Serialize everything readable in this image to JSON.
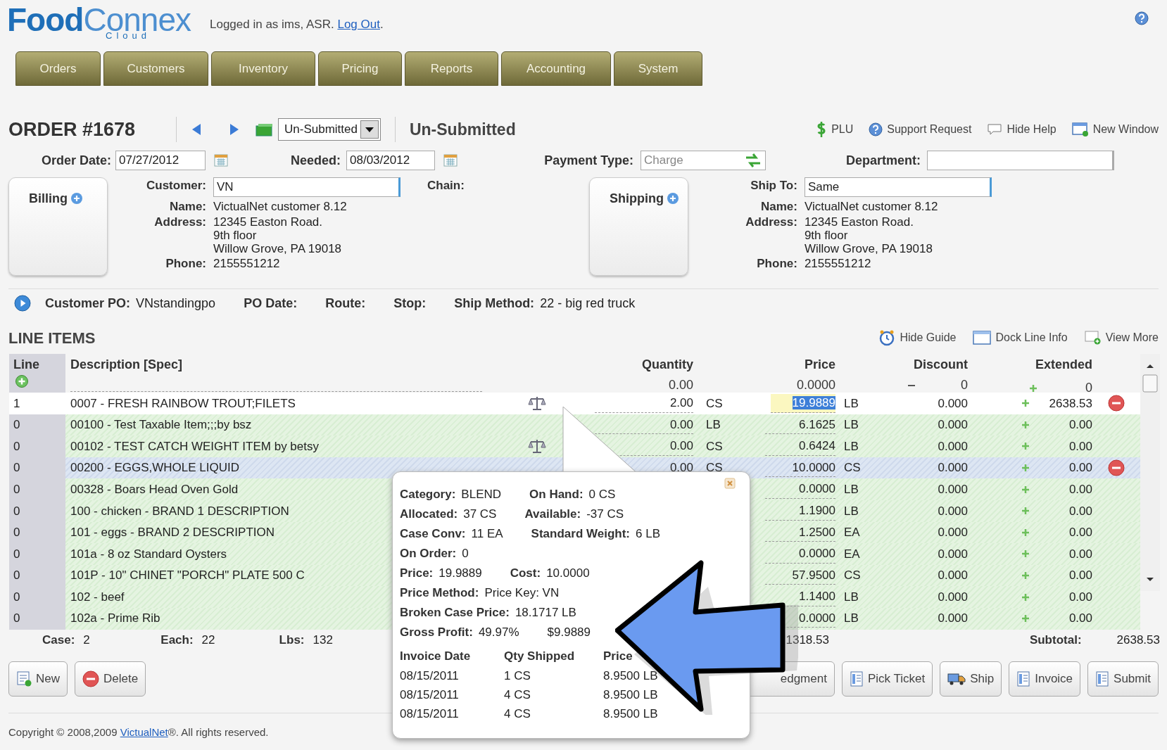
{
  "header": {
    "logo": {
      "primary": "Food",
      "secondary": "Connex",
      "sub": "Cloud"
    },
    "session": {
      "text": "Logged in as ims, ASR. ",
      "link": "Log Out",
      "after": "."
    }
  },
  "nav_tabs": [
    "Orders",
    "Customers",
    "Inventory",
    "Pricing",
    "Reports",
    "Accounting",
    "System"
  ],
  "order": {
    "title": "ORDER #1678",
    "status_select": "Un-Submitted",
    "status": "Un-Submitted",
    "actions": [
      {
        "label": "PLU",
        "kind": "dollar"
      },
      {
        "label": "Support Request",
        "kind": "help"
      },
      {
        "label": "Hide Help",
        "kind": "bubble"
      },
      {
        "label": "New Window",
        "kind": "window"
      }
    ]
  },
  "dates": {
    "order_date_label": "Order Date:",
    "order_date": "07/27/2012",
    "needed_label": "Needed:",
    "needed": "08/03/2012",
    "payment_type_label": "Payment Type:",
    "payment_type_placeholder": "Charge",
    "department_label": "Department:"
  },
  "billing": {
    "tab": "Billing",
    "chain_label": "Chain:",
    "fields": [
      {
        "label": "Customer:",
        "kind": "input",
        "value": "VN"
      },
      {
        "label": "Name:",
        "kind": "text",
        "lines": [
          "VictualNet customer 8.12"
        ]
      },
      {
        "label": "Address:",
        "kind": "text",
        "lines": [
          "12345 Easton Road.",
          "9th floor",
          "Willow Grove, PA 19018"
        ]
      },
      {
        "label": "Phone:",
        "kind": "text",
        "lines": [
          "2155551212"
        ]
      }
    ]
  },
  "shipping": {
    "tab": "Shipping",
    "fields": [
      {
        "label": "Ship To:",
        "kind": "input",
        "value": "Same"
      },
      {
        "label": "Name:",
        "kind": "text",
        "lines": [
          "VictualNet customer 8.12"
        ]
      },
      {
        "label": "Address:",
        "kind": "text",
        "lines": [
          "12345 Easton Road.",
          "9th floor",
          "Willow Grove, PA 19018"
        ]
      },
      {
        "label": "Phone:",
        "kind": "text",
        "lines": [
          "2155551212"
        ]
      }
    ]
  },
  "po_bar": [
    {
      "label": "Customer PO:",
      "value": "VNstandingpo"
    },
    {
      "label": "PO Date:"
    },
    {
      "label": "Route:"
    },
    {
      "label": "Stop:"
    },
    {
      "label": "Ship Method:",
      "value": "22 - big red truck"
    }
  ],
  "line_items": {
    "title": "LINE ITEMS",
    "tools": [
      {
        "label": "Hide Guide",
        "kind": "clock"
      },
      {
        "label": "Dock Line Info",
        "kind": "panel"
      },
      {
        "label": "View More",
        "kind": "more"
      }
    ],
    "columns": {
      "line": "Line",
      "description": "Description [Spec]",
      "quantity": "Quantity",
      "price": "Price",
      "discount": "Discount",
      "extended": "Extended"
    },
    "header_values": {
      "quantity": "0.00",
      "price": "0.0000",
      "discount": "0",
      "extended": "0"
    },
    "rows": [
      {
        "line": "1",
        "description": "0007 - FRESH RAINBOW TROUT;FILETS",
        "catch_weight": true,
        "quantity": "2.00",
        "qty_unit": "CS",
        "price": "19.9889",
        "price_unit": "LB",
        "discount": "0.000",
        "extended": "2638.53",
        "active": true,
        "selected": false
      },
      {
        "line": "0",
        "description": "00100 - Test Taxable Item;;;by bsz",
        "catch_weight": false,
        "quantity": "0.00",
        "qty_unit": "LB",
        "price": "6.1625",
        "price_unit": "LB",
        "discount": "0.000",
        "extended": "0.00",
        "active": false,
        "selected": false
      },
      {
        "line": "0",
        "description": "00102 - TEST CATCH WEIGHT ITEM by betsy",
        "catch_weight": true,
        "quantity": "0.00",
        "qty_unit": "CS",
        "price": "0.6424",
        "price_unit": "LB",
        "discount": "0.000",
        "extended": "0.00",
        "active": false,
        "selected": false
      },
      {
        "line": "0",
        "description": "00200 - EGGS,WHOLE LIQUID",
        "catch_weight": false,
        "quantity": "0.00",
        "qty_unit": "CS",
        "price": "10.0000",
        "price_unit": "CS",
        "discount": "0.000",
        "extended": "0.00",
        "active": false,
        "selected": true
      },
      {
        "line": "0",
        "description": "00328 - Boars Head Oven Gold",
        "catch_weight": false,
        "price": "0.0000",
        "price_unit": "LB",
        "discount": "0.000",
        "extended": "0.00",
        "active": false,
        "selected": false
      },
      {
        "line": "0",
        "description": "100 - chicken - BRAND 1 DESCRIPTION",
        "catch_weight": false,
        "price": "1.1900",
        "price_unit": "LB",
        "discount": "0.000",
        "extended": "0.00",
        "active": false,
        "selected": false
      },
      {
        "line": "0",
        "description": "101 - eggs - BRAND 2 DESCRIPTION",
        "catch_weight": false,
        "price": "1.2500",
        "price_unit": "EA",
        "discount": "0.000",
        "extended": "0.00",
        "active": false,
        "selected": false
      },
      {
        "line": "0",
        "description": "101a - 8 oz Standard Oysters",
        "catch_weight": false,
        "price": "0.0000",
        "price_unit": "EA",
        "discount": "0.000",
        "extended": "0.00",
        "active": false,
        "selected": false
      },
      {
        "line": "0",
        "description": "101P - 10\" CHINET \"PORCH\" PLATE 500 C",
        "catch_weight": false,
        "price": "57.9500",
        "price_unit": "CS",
        "discount": "0.000",
        "extended": "0.00",
        "active": false,
        "selected": false
      },
      {
        "line": "0",
        "description": "102 - beef",
        "catch_weight": false,
        "price": "1.1400",
        "price_unit": "LB",
        "discount": "0.000",
        "extended": "0.00",
        "active": false,
        "selected": false
      },
      {
        "line": "0",
        "description": "102a - Prime Rib",
        "catch_weight": false,
        "price": "0.0000",
        "price_unit": "LB",
        "discount": "0.000",
        "extended": "0.00",
        "active": false,
        "selected": false
      }
    ],
    "totals": [
      {
        "label": "Case:",
        "value": "2"
      },
      {
        "label": "Each:",
        "value": "22"
      },
      {
        "label": "Lbs:",
        "value": "132"
      }
    ],
    "partial_total": "1318.53",
    "subtotal_label": "Subtotal:",
    "subtotal": "2638.53"
  },
  "buttons_left": [
    {
      "label": "New",
      "kind": "new"
    },
    {
      "label": "Delete",
      "kind": "delete"
    }
  ],
  "buttons_right": [
    {
      "label": "edgment",
      "kind": "none"
    },
    {
      "label": "Pick Ticket",
      "kind": "doc"
    },
    {
      "label": "Ship",
      "kind": "truck"
    },
    {
      "label": "Invoice",
      "kind": "doc"
    },
    {
      "label": "Submit",
      "kind": "doc"
    }
  ],
  "footer": {
    "text": "Copyright © 2008,2009 ",
    "link": "VictualNet",
    "after": "®. All rights reserved."
  },
  "popup": {
    "lines": [
      [
        {
          "label": "Category:",
          "value": "BLEND"
        },
        {
          "label": "On Hand:",
          "value": "0 CS"
        }
      ],
      [
        {
          "label": "Allocated:",
          "value": "37 CS"
        },
        {
          "label": "Available:",
          "value": "-37 CS"
        }
      ],
      [
        {
          "label": "Case Conv:",
          "value": "11 EA"
        },
        {
          "label": "Standard Weight:",
          "value": "6 LB"
        }
      ],
      [
        {
          "label": "On Order:",
          "value": "0"
        }
      ],
      [
        {
          "label": "Price:",
          "value": "19.9889"
        },
        {
          "label": "Cost:",
          "value": "10.0000"
        }
      ],
      [
        {
          "label": "Price Method:",
          "value": "Price Key: VN"
        }
      ],
      [
        {
          "label": "Broken Case Price:",
          "value": "18.1717 LB"
        }
      ],
      [
        {
          "label": "Gross Profit:",
          "value": "49.97%"
        },
        {
          "value": "$9.9889"
        }
      ]
    ],
    "history": {
      "columns": [
        "Invoice Date",
        "Qty Shipped",
        "Price"
      ],
      "rows": [
        [
          "08/15/2011",
          "1 CS",
          "8.9500 LB"
        ],
        [
          "08/15/2011",
          "4 CS",
          "8.9500 LB"
        ],
        [
          "08/15/2011",
          "4 CS",
          "8.9500 LB"
        ]
      ]
    }
  }
}
